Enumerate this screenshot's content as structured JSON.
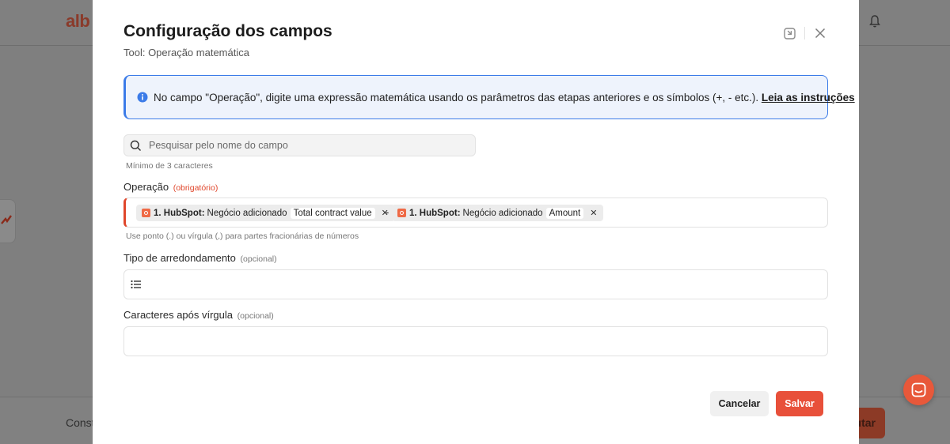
{
  "background": {
    "logo_text": "alb",
    "footer_text": "Const",
    "execute_button_label": "utar"
  },
  "modal": {
    "title": "Configuração dos campos",
    "subtitle": "Tool: Operação matemática",
    "info": {
      "text": "No campo \"Operação\", digite uma expressão matemática usando os parâmetros das etapas anteriores e os símbolos (+, - etc.). ",
      "link": "Leia as instruções",
      "accent_color": "#3b7be8"
    },
    "search": {
      "placeholder": "Pesquisar pelo nome do campo",
      "value": "",
      "hint": "Mínimo de 3 caracteres"
    },
    "operation": {
      "label": "Operação",
      "required_tag": "(obrigatório)",
      "tokens": [
        {
          "step": "1. HubSpot:",
          "event": "Negócio adicionado",
          "param": "Total contract value"
        },
        {
          "step": "1. HubSpot:",
          "event": "Negócio adicionado",
          "param": "Amount"
        }
      ],
      "operator": "-",
      "hint": "Use ponto (.) ou vírgula (,) para partes fracionárias de números"
    },
    "rounding": {
      "label": "Tipo de arredondamento",
      "optional_tag": "(opcional)",
      "value": ""
    },
    "decimals": {
      "label": "Caracteres após vírgula",
      "optional_tag": "(opcional)",
      "value": ""
    },
    "buttons": {
      "cancel": "Cancelar",
      "save": "Salvar"
    },
    "colors": {
      "brand": "#e8503a",
      "required": "#e0462b"
    }
  }
}
